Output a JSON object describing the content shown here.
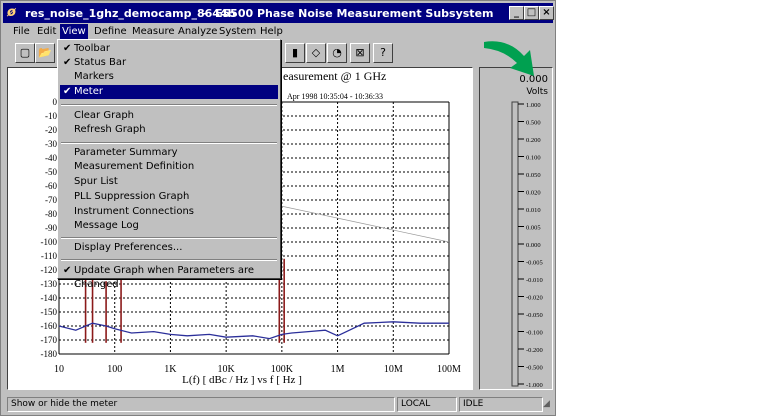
{
  "window": {
    "title_doc": "res_noise_1ghz_democamp_8644b",
    "title_sep": "-",
    "title_app": "E5500 Phase Noise Measurement Subsystem",
    "minimize": "_",
    "maximize": "□",
    "close": "×"
  },
  "menubar": [
    "File",
    "Edit",
    "View",
    "Define",
    "Measure",
    "Analyze",
    "System",
    "Help"
  ],
  "view_menu": {
    "items": [
      {
        "label": "Toolbar",
        "checked": true
      },
      {
        "label": "Status Bar",
        "checked": true
      },
      {
        "label": "Markers",
        "checked": false
      },
      {
        "label": "Meter",
        "checked": true,
        "selected": true
      },
      {
        "label": "Clear Graph"
      },
      {
        "label": "Refresh Graph"
      },
      {
        "label": "Parameter Summary"
      },
      {
        "label": "Measurement Definition"
      },
      {
        "label": "Spur List"
      },
      {
        "label": "PLL Suppression Graph"
      },
      {
        "label": "Instrument Connections"
      },
      {
        "label": "Message Log"
      },
      {
        "label": "Display Preferences..."
      },
      {
        "label": "Update Graph when Parameters are Changed",
        "checked": true
      }
    ]
  },
  "graph": {
    "title": "easurement @ 1 GHz",
    "subtitle": "Apr 1998  10:35:04 - 10:36:33",
    "y_ticks": [
      "0",
      "-10",
      "-20",
      "-30",
      "-40",
      "-50",
      "-60",
      "-70",
      "-80",
      "-90",
      "-100",
      "-110",
      "-120",
      "-130",
      "-140",
      "-150",
      "-160",
      "-170",
      "-180"
    ],
    "x_ticks": [
      "10",
      "100",
      "1K",
      "10K",
      "100K",
      "1M",
      "10M",
      "100M"
    ],
    "x_label": "L(f)  [ dBc / Hz ]  vs  f  [ Hz ]",
    "trace_color": "#2b2f9a",
    "spur_color": "#8b1a1a"
  },
  "meter": {
    "value": "0.000",
    "unit": "Volts",
    "ticks": [
      "1.000",
      "0.500",
      "0.200",
      "0.100",
      "0.050",
      "0.020",
      "0.010",
      "0.005",
      "0.000",
      "-0.005",
      "-0.010",
      "-0.020",
      "-0.050",
      "-0.100",
      "-0.200",
      "-0.500",
      "-1.000"
    ]
  },
  "statusbar": {
    "hint": "Show or hide the meter",
    "mode": "LOCAL",
    "state": "IDLE"
  },
  "chart_data": {
    "type": "line",
    "xscale": "log",
    "x_ticks": [
      "10",
      "100",
      "1K",
      "10K",
      "100K",
      "1M",
      "10M",
      "100M"
    ],
    "ylim": [
      -180,
      0
    ],
    "xlabel": "L(f)  [ dBc / Hz ]  vs  f  [ Hz ]",
    "series": [
      {
        "x": [
          10,
          20,
          40,
          70,
          100,
          200,
          500,
          1000,
          2000,
          5000,
          10000,
          30000,
          60000,
          100000,
          150000,
          300000,
          600000,
          1000000,
          3000000,
          10000000,
          30000000,
          100000000
        ],
        "y": [
          -160,
          -163,
          -158,
          -160,
          -162,
          -165,
          -164,
          -166,
          -167,
          -166,
          -168,
          -167,
          -169,
          -166,
          -165,
          -164,
          -163,
          -167,
          -158,
          -157,
          -158,
          -158
        ]
      }
    ]
  }
}
